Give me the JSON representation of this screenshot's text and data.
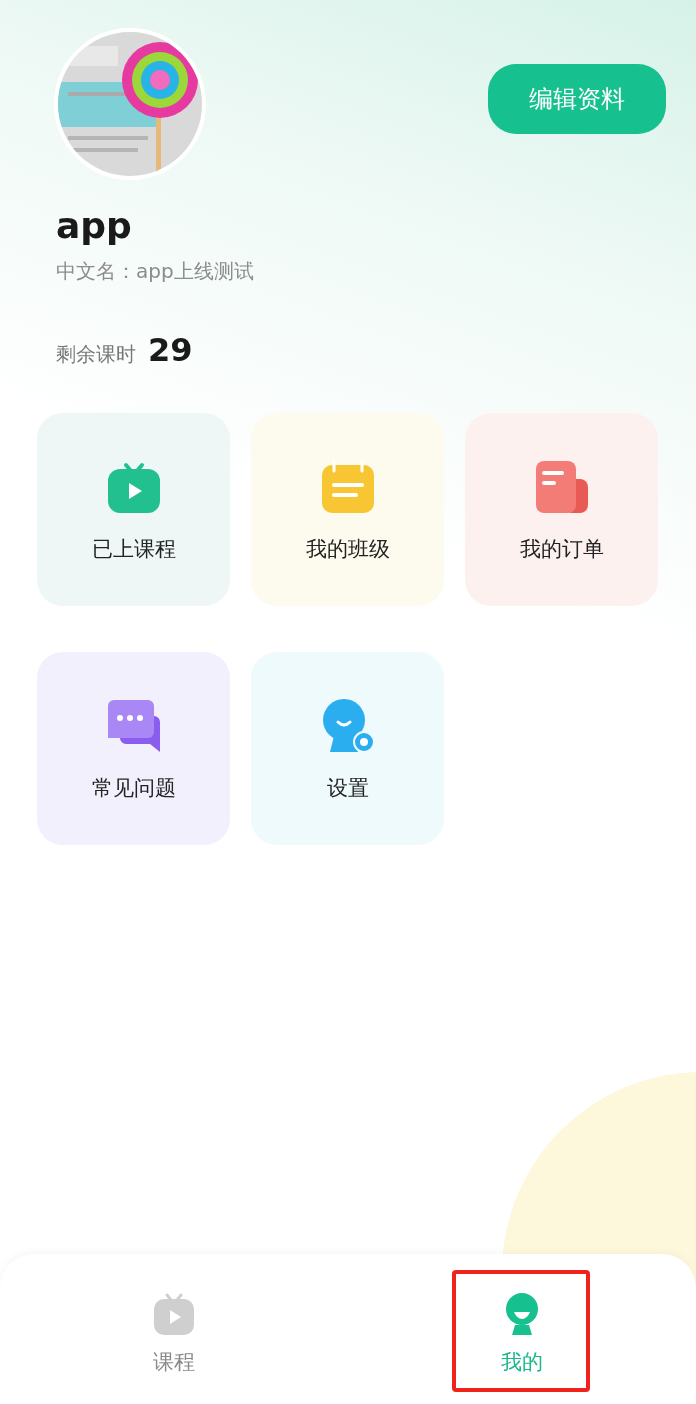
{
  "profile": {
    "edit_button": "编辑资料",
    "name": "app",
    "chinese_name": "中文名：app上线测试",
    "remaining_label": "剩余课时",
    "remaining_value": "29"
  },
  "menu": [
    {
      "kind": "tv",
      "label": "已上课程",
      "color": "#eef7f5"
    },
    {
      "kind": "calendar",
      "label": "我的班级",
      "color": "#fdfaee"
    },
    {
      "kind": "order",
      "label": "我的订单",
      "color": "#fdf1f0"
    },
    {
      "kind": "chat",
      "label": "常见问题",
      "color": "#f3f0fd"
    },
    {
      "kind": "settings",
      "label": "设置",
      "color": "#eefafb"
    }
  ],
  "tab_bar": [
    {
      "kind": "tv",
      "label": "课程",
      "selected": false,
      "highlighted": false
    },
    {
      "kind": "person",
      "label": "我的",
      "selected": true,
      "highlighted": true
    }
  ]
}
